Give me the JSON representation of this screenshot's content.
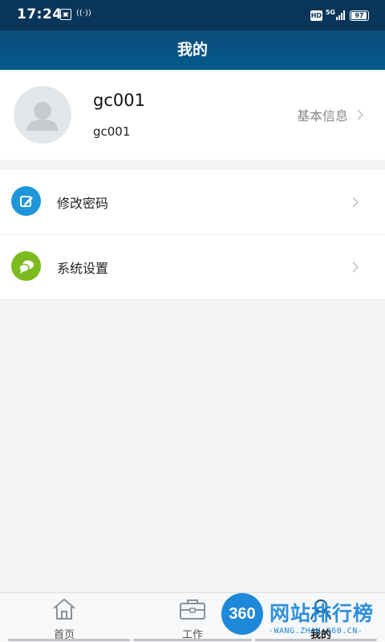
{
  "status_bar": {
    "time": "17:24",
    "hd_label": "HD",
    "network_label": "5G",
    "battery_level": "97",
    "battery_fraction": 0.97
  },
  "header": {
    "title": "我的"
  },
  "profile": {
    "name": "gc001",
    "account": "gc001",
    "info_link_label": "基本信息"
  },
  "menu": {
    "items": [
      {
        "label": "修改密码",
        "icon": "edit-password-icon",
        "icon_color": "#1f96d8"
      },
      {
        "label": "系统设置",
        "icon": "chat-bubbles-icon",
        "icon_color": "#7cbb1e"
      }
    ]
  },
  "bottom_nav": {
    "items": [
      {
        "label": "首页",
        "icon": "home-icon"
      },
      {
        "label": "工作",
        "icon": "briefcase-icon"
      },
      {
        "label": "我的",
        "icon": "person-icon",
        "active": true
      }
    ]
  },
  "watermark": {
    "logo_text": "360",
    "title": "网站排行榜",
    "url": "-WANG.ZHAN.360.CN-"
  },
  "colors": {
    "status_bar": "#09355a",
    "header": "#065a8e",
    "background": "#f3f4f6",
    "watermark_blue": "#1e88d9"
  }
}
